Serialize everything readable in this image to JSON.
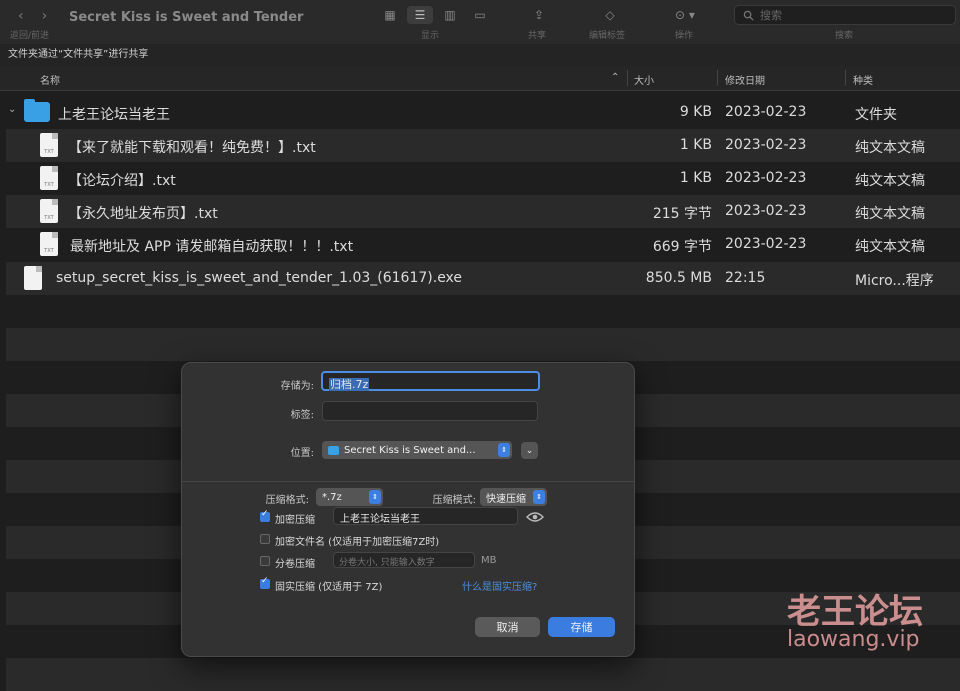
{
  "toolbar": {
    "window_title": "Secret Kiss is Sweet and Tender",
    "nav_caption": "返回/前进",
    "view_caption": "显示",
    "share_caption": "共享",
    "tags_caption": "编辑标签",
    "action_caption": "操作",
    "search_caption": "搜索",
    "search_placeholder": "搜索"
  },
  "share_bar": {
    "text": "文件夹通过“文件共享”进行共享"
  },
  "columns": {
    "name": "名称",
    "size": "大小",
    "date": "修改日期",
    "kind": "种类"
  },
  "files": [
    {
      "name": "上老王论坛当老王",
      "size": "9 KB",
      "date": "2023-02-23",
      "kind": "文件夹",
      "icon": "folder-icon"
    },
    {
      "name": "【来了就能下载和观看！纯免费！】.txt",
      "size": "1 KB",
      "date": "2023-02-23",
      "kind": "纯文本文稿",
      "icon": "txt-file-icon"
    },
    {
      "name": "【论坛介绍】.txt",
      "size": "1 KB",
      "date": "2023-02-23",
      "kind": "纯文本文稿",
      "icon": "txt-file-icon"
    },
    {
      "name": "【永久地址发布页】.txt",
      "size": "215 字节",
      "date": "2023-02-23",
      "kind": "纯文本文稿",
      "icon": "txt-file-icon"
    },
    {
      "name": "最新地址及 APP 请发邮箱自动获取！！！.txt",
      "size": "669 字节",
      "date": "2023-02-23",
      "kind": "纯文本文稿",
      "icon": "txt-file-icon"
    },
    {
      "name": "setup_secret_kiss_is_sweet_and_tender_1.03_(61617).exe",
      "size": "850.5 MB",
      "date": "22:15",
      "kind": "Micro...程序",
      "icon": "exe-file-icon"
    }
  ],
  "txt_icon_label": "TXT",
  "dialog": {
    "save_as_label": "存储为:",
    "save_as_value": "归档.7z",
    "tags_label": "标签:",
    "location_label": "位置:",
    "location_value": "Secret Kiss is Sweet and...",
    "format_label": "压缩格式:",
    "format_value": "*.7z",
    "mode_label": "压缩模式:",
    "mode_value": "快速压缩",
    "encrypt_label": "加密压缩",
    "encrypt_checked": true,
    "password_value": "上老王论坛当老王",
    "encrypt_names_label": "加密文件名 (仅适用于加密压缩7Z时)",
    "encrypt_names_checked": false,
    "split_label": "分卷压缩",
    "split_checked": false,
    "split_placeholder": "分卷大小, 只能输入数字",
    "split_unit": "MB",
    "solid_label": "固实压缩 (仅适用于 7Z)",
    "solid_checked": true,
    "solid_link": "什么是固实压缩?",
    "cancel_label": "取消",
    "save_label": "存储"
  },
  "watermark": {
    "line1": "老王论坛",
    "line2": "laowang.vip"
  },
  "colors": {
    "accent": "#3a7ce0",
    "folder": "#3aa0e6",
    "watermark": "#e8a0a0"
  }
}
